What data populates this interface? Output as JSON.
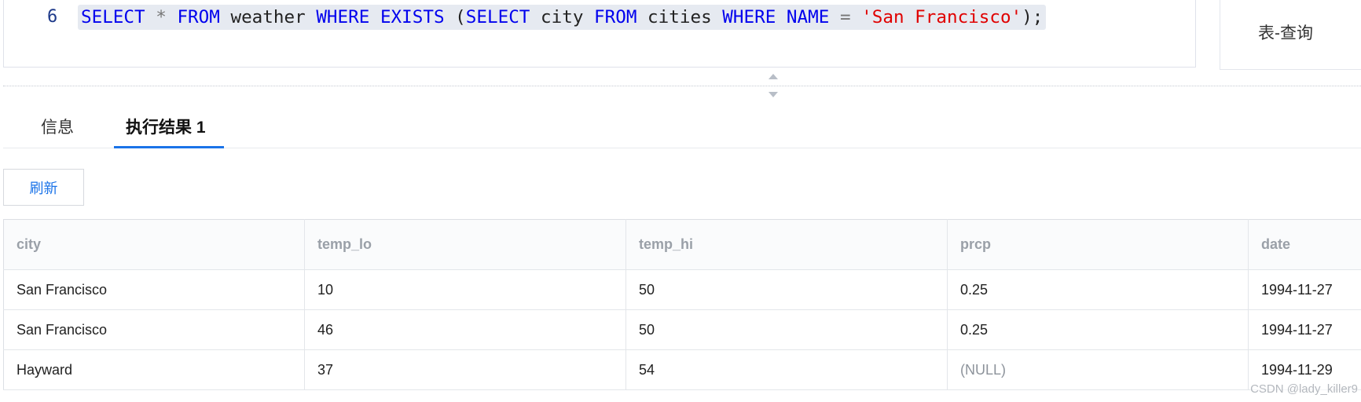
{
  "editor": {
    "line_number": "6",
    "tokens": {
      "t1": "SELECT",
      "t2": " ",
      "t3": "*",
      "t4": " ",
      "t5": "FROM",
      "t6": " weather ",
      "t7": "WHERE",
      "t8": " ",
      "t9": "EXISTS",
      "t10": " (",
      "t11": "SELECT",
      "t12": " city ",
      "t13": "FROM",
      "t14": " cities ",
      "t15": "WHERE",
      "t16": " ",
      "t17": "NAME",
      "t18": " ",
      "t19": "=",
      "t20": " ",
      "t21": "'San Francisco'",
      "t22": ");"
    }
  },
  "side_panel": {
    "label": "表-查询"
  },
  "tabs": [
    {
      "label": "信息"
    },
    {
      "label": "执行结果 1"
    }
  ],
  "refresh_label": "刷新",
  "table": {
    "columns": [
      "city",
      "temp_lo",
      "temp_hi",
      "prcp",
      "date"
    ],
    "rows": [
      [
        "San Francisco",
        "10",
        "50",
        "0.25",
        "1994-11-27"
      ],
      [
        "San Francisco",
        "46",
        "50",
        "0.25",
        "1994-11-27"
      ],
      [
        "Hayward",
        "37",
        "54",
        "(NULL)",
        "1994-11-29"
      ]
    ]
  },
  "watermark": "CSDN @lady_killer9",
  "colors": {
    "accent": "#1a73e8",
    "keyword": "#0000ee",
    "string": "#e00000"
  }
}
